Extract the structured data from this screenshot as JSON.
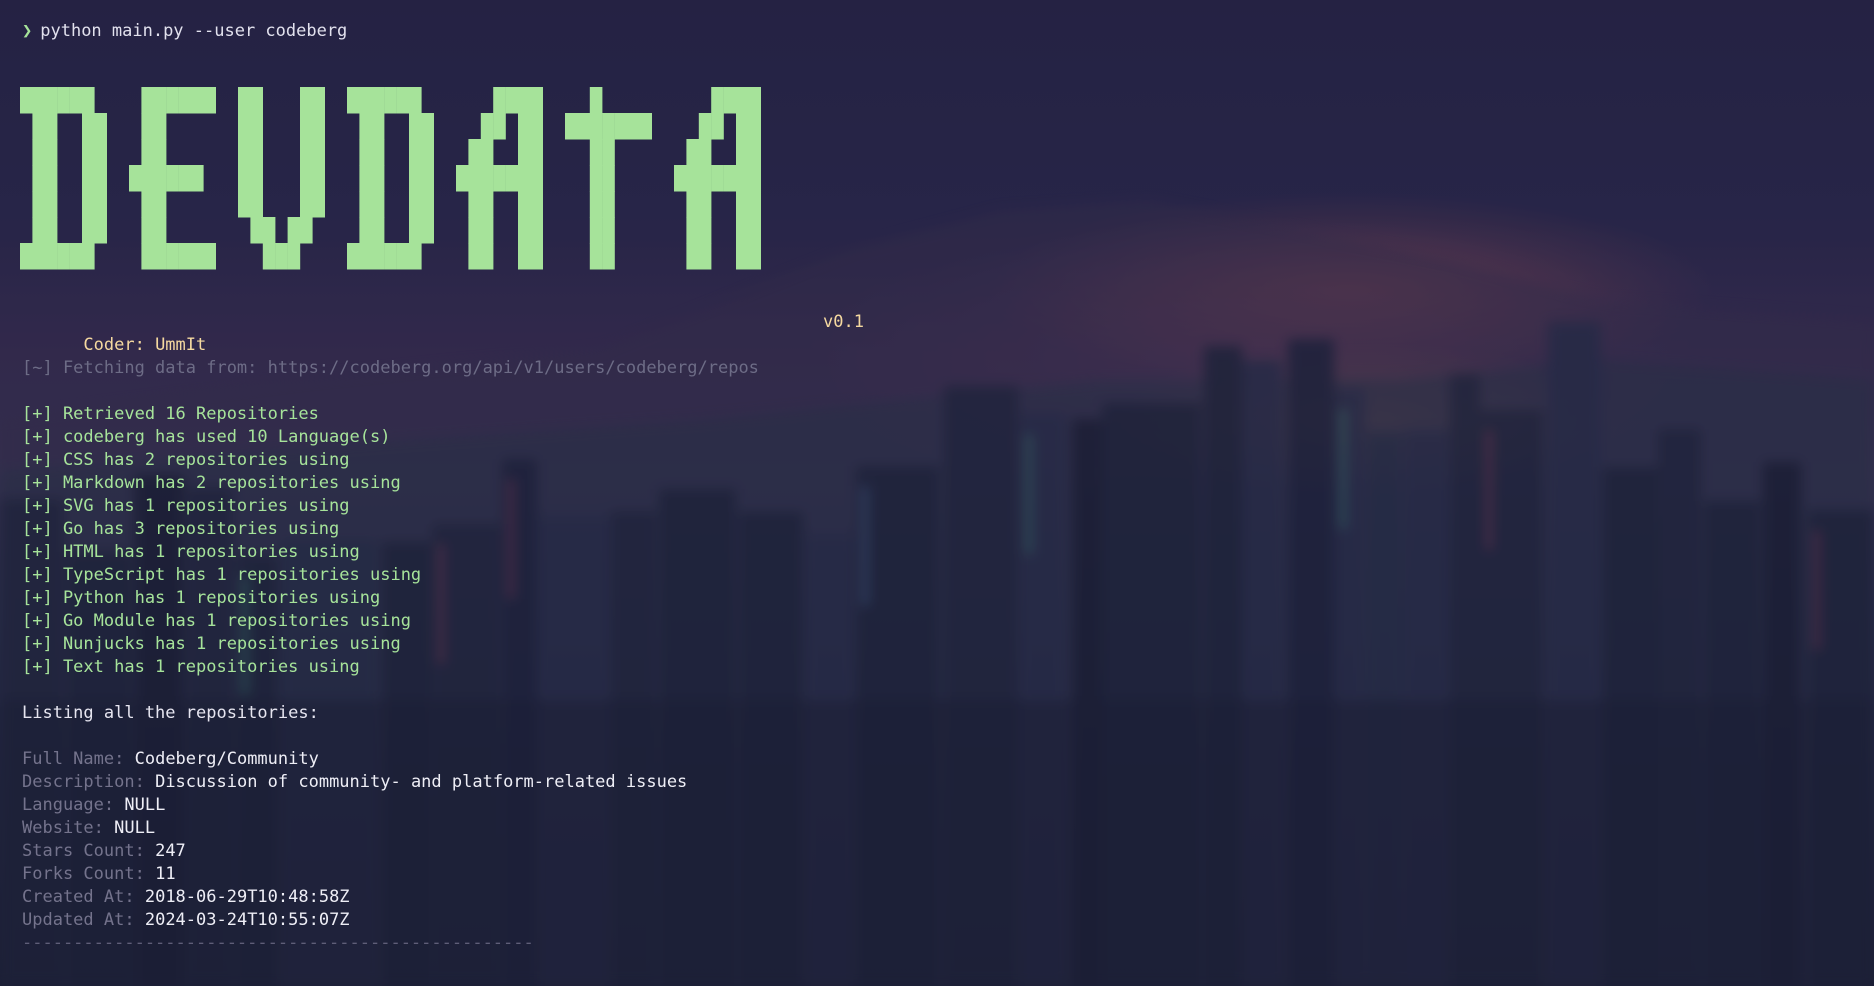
{
  "terminal": {
    "prompt_symbol": "❯",
    "command": "python main.py --user codeberg",
    "banner_text": "DEVDATA",
    "coder_label": "Coder: UmmIt",
    "version": "v0.1",
    "fetch_line": "[~] Fetching data from: https://codeberg.org/api/v1/users/codeberg/repos",
    "results": [
      "[+] Retrieved 16 Repositories",
      "[+] codeberg has used 10 Language(s)",
      "[+] CSS has 2 repositories using",
      "[+] Markdown has 2 repositories using",
      "[+] SVG has 1 repositories using",
      "[+] Go has 3 repositories using",
      "[+] HTML has 1 repositories using",
      "[+] TypeScript has 1 repositories using",
      "[+] Python has 1 repositories using",
      "[+] Go Module has 1 repositories using",
      "[+] Nunjucks has 1 repositories using",
      "[+] Text has 1 repositories using"
    ],
    "listing_heading": "Listing all the repositories:",
    "repo": {
      "full_name_label": "Full Name:",
      "full_name": "Codeberg/Community",
      "description_label": "Description:",
      "description": "Discussion of community- and platform-related issues",
      "language_label": "Language:",
      "language": "NULL",
      "website_label": "Website:",
      "website": "NULL",
      "stars_label": "Stars Count:",
      "stars": "247",
      "forks_label": "Forks Count:",
      "forks": "11",
      "created_label": "Created At:",
      "created": "2018-06-29T10:48:58Z",
      "updated_label": "Updated At:",
      "updated": "2024-03-24T10:55:07Z"
    },
    "divider": "--------------------------------------------------"
  },
  "colors": {
    "accent_green": "#a6e39a",
    "coder_yellow": "#f5d9a0",
    "muted_label": "#74738c",
    "background": "#2b2850"
  }
}
